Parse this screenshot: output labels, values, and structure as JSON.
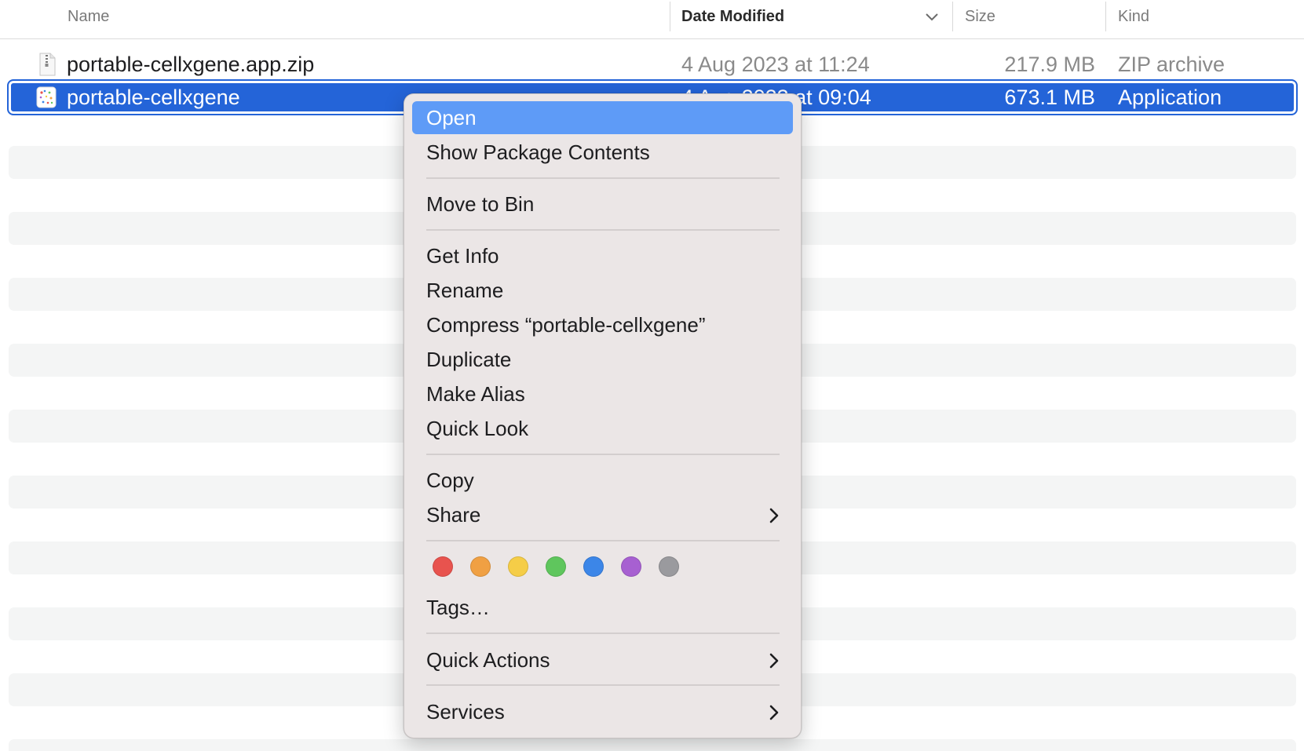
{
  "columns": {
    "name": "Name",
    "date": "Date Modified",
    "size": "Size",
    "kind": "Kind"
  },
  "files": [
    {
      "name": "portable-cellxgene.app.zip",
      "date": "4 Aug 2023 at 11:24",
      "size": "217.9 MB",
      "kind": "ZIP archive",
      "icon": "zip-file-icon"
    },
    {
      "name": "portable-cellxgene",
      "date": "4 Aug 2023 at 09:04",
      "size": "673.1 MB",
      "kind": "Application",
      "icon": "app-icon"
    }
  ],
  "context_menu": {
    "open": "Open",
    "show_package_contents": "Show Package Contents",
    "move_to_bin": "Move to Bin",
    "get_info": "Get Info",
    "rename": "Rename",
    "compress": "Compress “portable-cellxgene”",
    "duplicate": "Duplicate",
    "make_alias": "Make Alias",
    "quick_look": "Quick Look",
    "copy": "Copy",
    "share": "Share",
    "tags": "Tags…",
    "quick_actions": "Quick Actions",
    "services": "Services"
  },
  "tag_colors": [
    "#e8534e",
    "#f0a043",
    "#f5cd47",
    "#5fc65d",
    "#3c86e8",
    "#a760d1",
    "#9a9a9e"
  ],
  "selection_color": "#2464d8",
  "highlight_color": "#5e9bf7"
}
